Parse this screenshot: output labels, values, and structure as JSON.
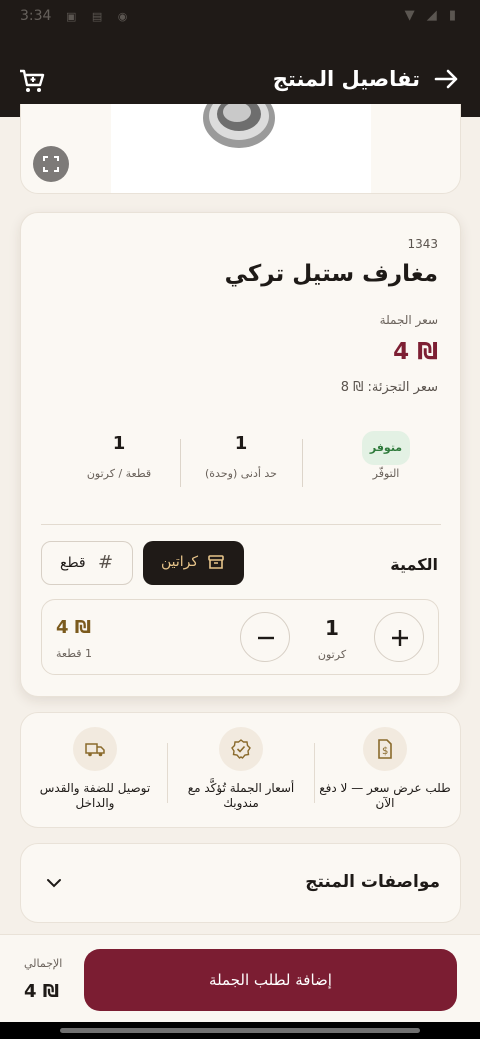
{
  "status_bar": {
    "time": "3:34"
  },
  "app_bar": {
    "title": "تفاصيل المنتج"
  },
  "product": {
    "sku": "1343",
    "name": "مغارف ستيل تركي",
    "wholesale_label": "سعر الجملة",
    "wholesale_price": "₪ 4",
    "retail_price": "سعر التجزئة: ₪ 8"
  },
  "stats": {
    "availability": {
      "value": "متوفر",
      "label": "التوفّر"
    },
    "minimum": {
      "value": "1",
      "label": "حد أدنى (وحدة)"
    },
    "per_carton": {
      "value": "1",
      "label": "قطعة / كرتون"
    }
  },
  "quantity": {
    "label": "الكمية",
    "unit_cartons": "كراتين",
    "unit_pieces": "قطع",
    "value": "1",
    "unit": "كرتون",
    "total": "₪ 4",
    "pieces": "1 قطعة"
  },
  "features": [
    {
      "icon": "invoice-icon",
      "text": "طلب عرض سعر — لا دفع الآن"
    },
    {
      "icon": "verified-badge-icon",
      "text": "أسعار الجملة تُؤكَّد مع مندوبك"
    },
    {
      "icon": "delivery-truck-icon",
      "text": "توصيل للضفة والقدس والداخل"
    }
  ],
  "specs": {
    "title": "مواصفات المنتج"
  },
  "bottom": {
    "total_label": "الإجمالي",
    "total_value": "₪ 4",
    "add_button": "إضافة لطلب الجملة"
  }
}
